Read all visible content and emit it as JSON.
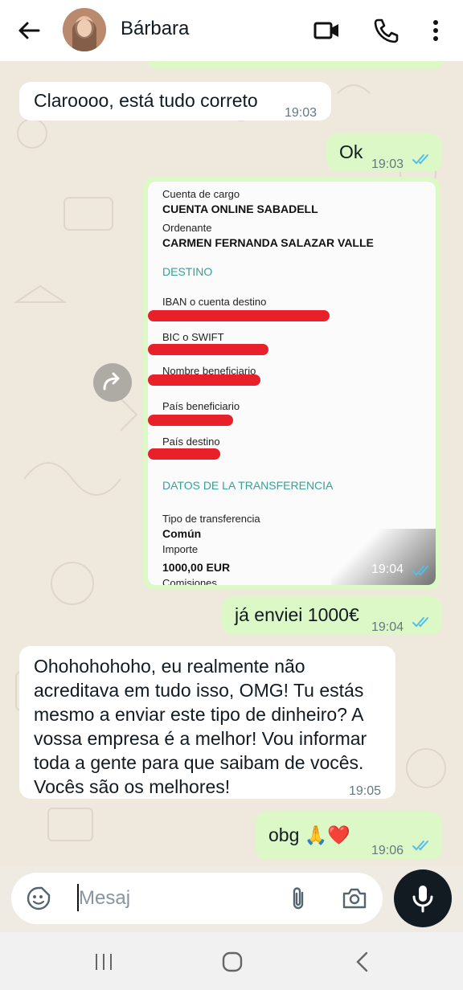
{
  "header": {
    "contact_name": "Bárbara",
    "icons": [
      "back-arrow-icon",
      "video-call-icon",
      "phone-icon",
      "more-vertical-icon"
    ]
  },
  "messages": [
    {
      "direction": "in",
      "text": "Claroooo, está tudo correto",
      "time": "19:03"
    },
    {
      "direction": "out",
      "text": "Ok",
      "time": "19:03",
      "status": "read"
    },
    {
      "direction": "out",
      "type": "image",
      "time": "19:04",
      "status": "read"
    },
    {
      "direction": "out",
      "text": "já enviei 1000€",
      "time": "19:04",
      "status": "read"
    },
    {
      "direction": "in",
      "lines": [
        "Ohohohohoho, eu realmente não",
        "acreditava em tudo isso, OMG! Tu estás",
        "mesmo a enviar este tipo de dinheiro? A",
        "vossa empresa é a melhor! Vou informar",
        "toda a gente para que saibam de vocês.",
        "Vocês são os melhores!"
      ],
      "time": "19:05"
    },
    {
      "direction": "out",
      "text": "obg 🙏❤️",
      "time": "19:06",
      "status": "read"
    }
  ],
  "transfer_doc": {
    "cuenta_label": "Cuenta de cargo",
    "cuenta_value": "CUENTA ONLINE SABADELL",
    "ordenante_label": "Ordenante",
    "ordenante_value": "CARMEN FERNANDA SALAZAR VALLE",
    "destino_section": "DESTINO",
    "iban_label": "IBAN o cuenta destino",
    "bic_label": "BIC o SWIFT",
    "beneficiario_label": "Nombre beneficiario",
    "pais_benef_label": "País beneficiario",
    "pais_destino_label": "País destino",
    "datos_section": "DATOS DE LA TRANSFERENCIA",
    "tipo_label": "Tipo de transferencia",
    "tipo_value": "Común",
    "importe_label": "Importe",
    "importe_value": "1000,00 EUR",
    "comisiones_label": "Comisiones"
  },
  "composer": {
    "placeholder": "Mesaj",
    "icons": [
      "sticker-icon",
      "attach-icon",
      "camera-icon",
      "mic-icon"
    ]
  },
  "colors": {
    "outgoing_bubble": "#dcf8c6",
    "incoming_bubble": "#ffffff",
    "read_ticks": "#53bdeb",
    "section_teal": "#3a9f96",
    "redaction_red": "#e8202a"
  }
}
